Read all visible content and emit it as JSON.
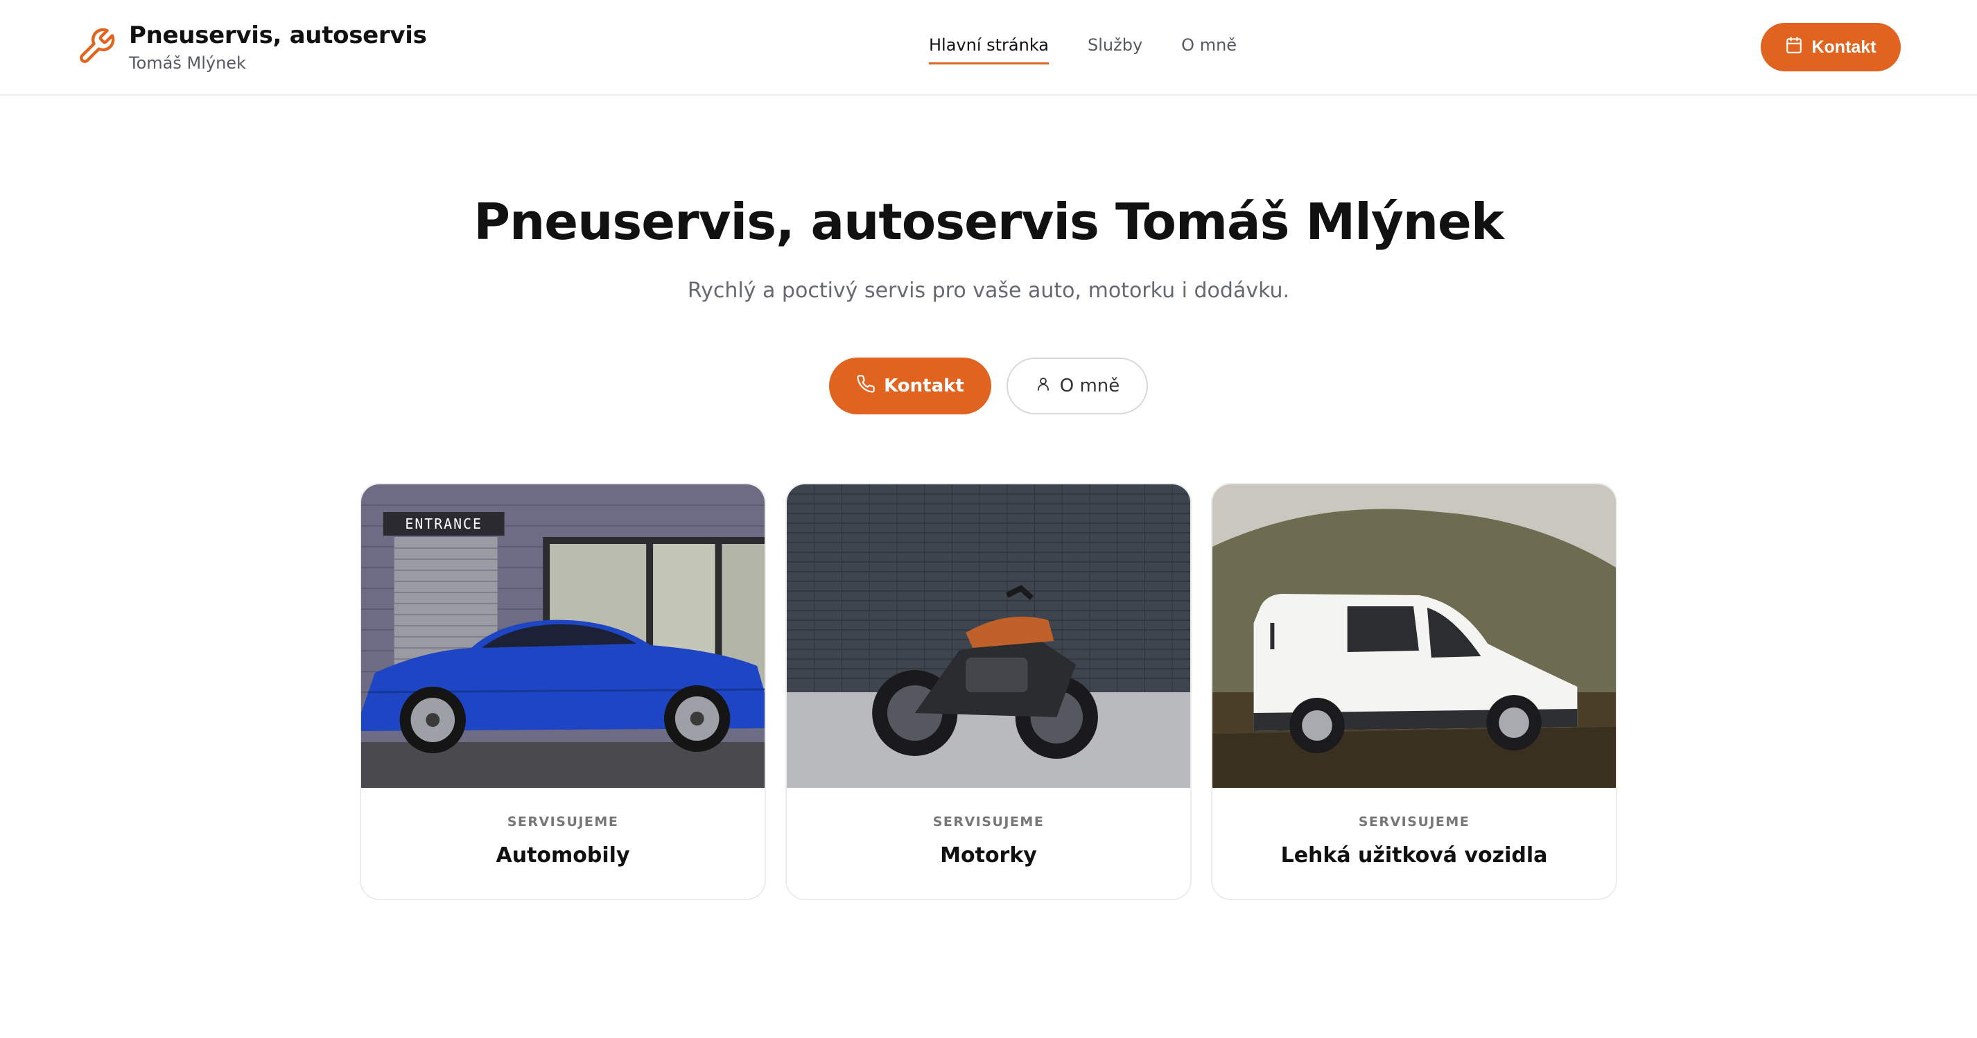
{
  "brand": {
    "title": "Pneuservis, autoservis",
    "subtitle": "Tomáš Mlýnek",
    "icon": "wrench-icon",
    "accent": "#e0641f"
  },
  "nav": {
    "items": [
      {
        "label": "Hlavní stránka",
        "active": true
      },
      {
        "label": "Služby",
        "active": false
      },
      {
        "label": "O mně",
        "active": false
      }
    ]
  },
  "header_cta": {
    "label": "Kontakt",
    "icon": "calendar-icon"
  },
  "hero": {
    "title": "Pneuservis, autoservis Tomáš Mlýnek",
    "subtitle": "Rychlý a poctivý servis pro vaše auto, motorku i dodávku.",
    "primary_button": {
      "label": "Kontakt",
      "icon": "phone-icon"
    },
    "secondary_button": {
      "label": "O mně",
      "icon": "user-icon"
    }
  },
  "cards": [
    {
      "kicker": "SERVISUJEME",
      "title": "Automobily",
      "image": "blue-car-photo"
    },
    {
      "kicker": "SERVISUJEME",
      "title": "Motorky",
      "image": "motorcycle-photo"
    },
    {
      "kicker": "SERVISUJEME",
      "title": "Lehká užitková vozidla",
      "image": "white-van-photo"
    }
  ],
  "photo_text": {
    "entrance_sign": "ENTRANCE"
  }
}
